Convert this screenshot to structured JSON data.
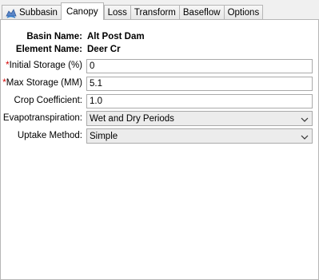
{
  "tabs": [
    {
      "label": "Subbasin",
      "icon": "subbasin-icon"
    },
    {
      "label": "Canopy"
    },
    {
      "label": "Loss"
    },
    {
      "label": "Transform"
    },
    {
      "label": "Baseflow"
    },
    {
      "label": "Options"
    }
  ],
  "active_tab": "Canopy",
  "info": {
    "basin_label": "Basin Name:",
    "basin_value": "Alt Post Dam",
    "element_label": "Element Name:",
    "element_value": "Deer Cr"
  },
  "fields": {
    "initial_storage": {
      "required_mark": "*",
      "label": "Initial Storage (%)",
      "value": "0"
    },
    "max_storage": {
      "required_mark": "*",
      "label": "Max Storage (MM)",
      "value": "5.1"
    },
    "crop_coefficient": {
      "label": "Crop Coefficient:",
      "value": "1.0"
    },
    "evapotranspiration": {
      "label": "Evapotranspiration:",
      "selected": "Wet and Dry Periods"
    },
    "uptake_method": {
      "label": "Uptake Method:",
      "selected": "Simple"
    }
  },
  "colors": {
    "required": "#d40000",
    "panel": "#ffffff",
    "background": "#f0f0f0"
  }
}
